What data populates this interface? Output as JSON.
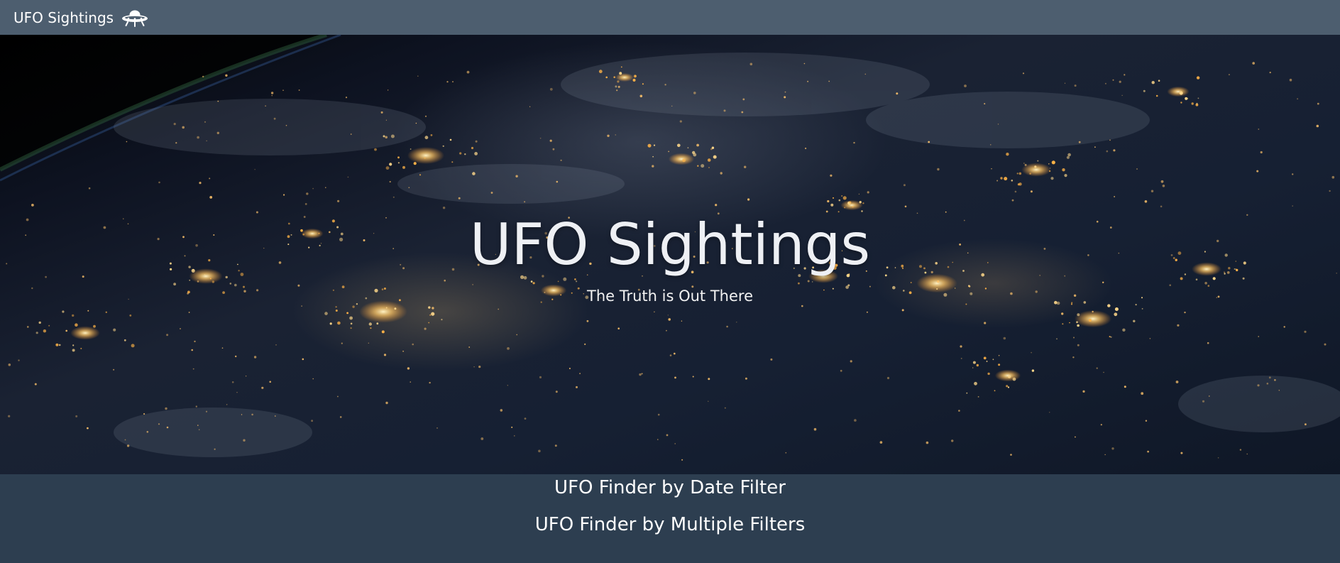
{
  "navbar": {
    "brand_label": "UFO Sightings",
    "brand_icon": "ufo-icon"
  },
  "hero": {
    "title": "UFO Sightings",
    "subtitle": "The Truth is Out There",
    "background": "earth-at-night-from-space"
  },
  "links": [
    {
      "label": "UFO Finder by Date Filter"
    },
    {
      "label": "UFO Finder by Multiple Filters"
    }
  ],
  "colors": {
    "navbar": "#4d5e6f",
    "footer": "#2d3e50",
    "text": "#ffffff"
  }
}
